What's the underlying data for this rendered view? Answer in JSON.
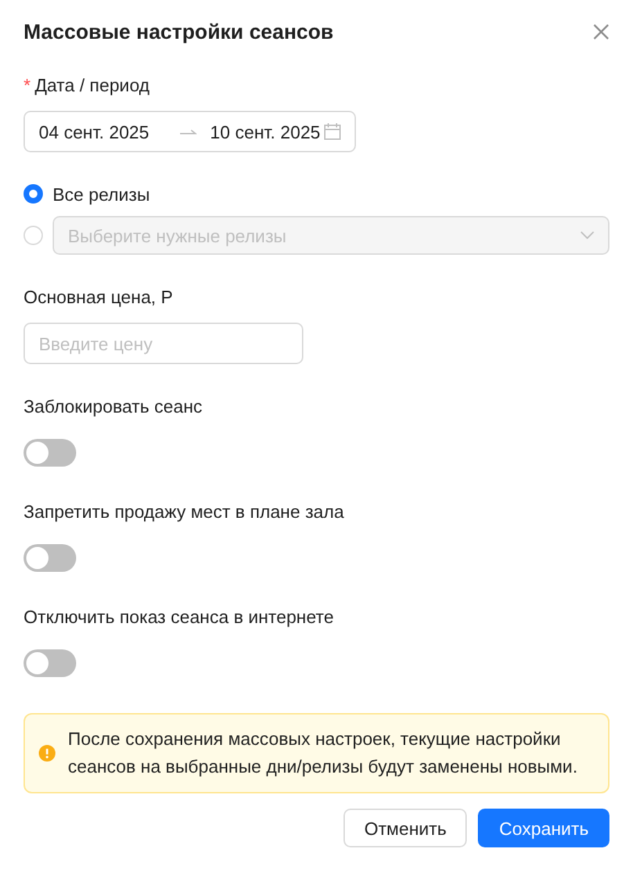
{
  "dialog": {
    "title": "Массовые настройки сеансов"
  },
  "date_period": {
    "required_mark": "*",
    "label": "Дата / период",
    "start": "04 сент. 2025",
    "end": "10 сент. 2025"
  },
  "release_options": [
    {
      "kind": "label",
      "label": "Все релизы",
      "selected": true
    },
    {
      "kind": "select",
      "placeholder": "Выберите нужные релизы",
      "selected": false,
      "disabled": true
    }
  ],
  "price": {
    "label": "Основная цена, Р",
    "placeholder": "Введите цену"
  },
  "toggles": [
    {
      "label": "Заблокировать сеанс",
      "on": false
    },
    {
      "label": "Запретить продажу мест в плане зала",
      "on": false
    },
    {
      "label": "Отключить показ сеанса в интернете",
      "on": false
    }
  ],
  "alert": {
    "text": "После сохранения массовых настроек, текущие настройки сеансов на выбранные дни/релизы будут заменены новыми."
  },
  "buttons": [
    {
      "kind": "secondary",
      "label": "Отменить"
    },
    {
      "kind": "primary",
      "label": "Сохранить"
    }
  ]
}
